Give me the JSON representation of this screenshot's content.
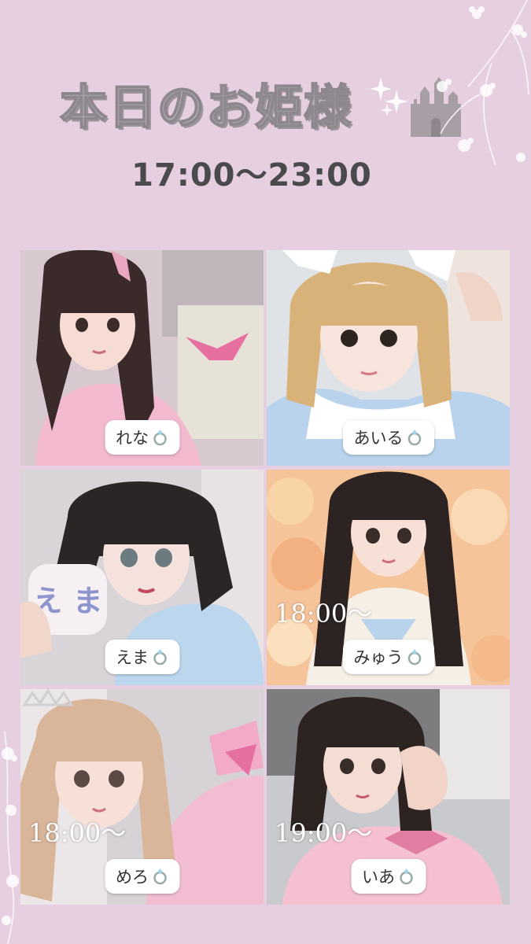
{
  "header": {
    "title": "本日のお姫様",
    "time_range": "17:00〜23:00"
  },
  "colors": {
    "background": "#e6cfe0",
    "title_fill": "#b9b2b8",
    "title_outline": "#8e8790",
    "time_text": "#4a4a4e",
    "badge_bg": "#ffffff"
  },
  "cast": [
    {
      "name": "れな",
      "icon": "ring-icon",
      "start_time": ""
    },
    {
      "name": "あいる",
      "icon": "ring-icon",
      "start_time": ""
    },
    {
      "name": "えま",
      "icon": "ring-icon",
      "start_time": ""
    },
    {
      "name": "みゅう",
      "icon": "ring-icon",
      "start_time": "18:00〜"
    },
    {
      "name": "めろ",
      "icon": "ring-icon",
      "start_time": "18:00〜"
    },
    {
      "name": "いあ",
      "icon": "ring-icon",
      "start_time": "19:00〜"
    }
  ]
}
